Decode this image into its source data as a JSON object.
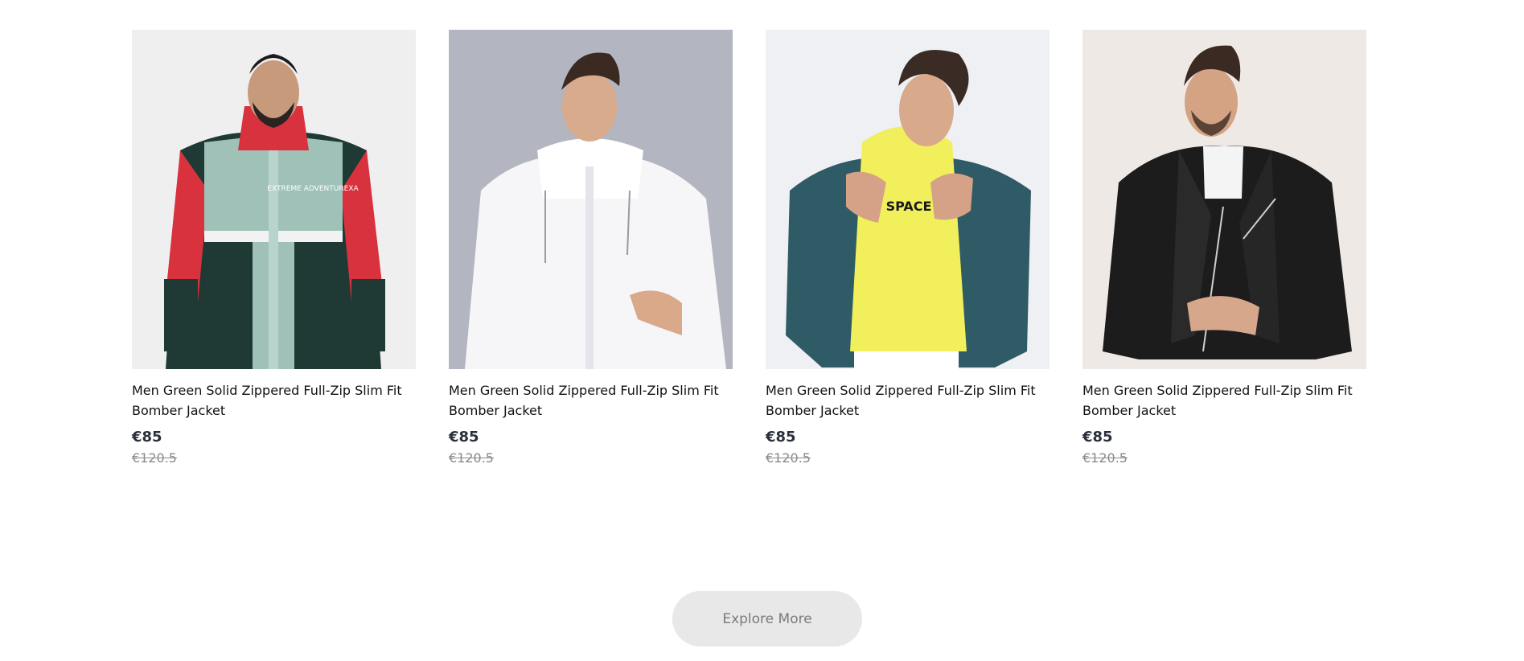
{
  "products": [
    {
      "name": "Men Green Solid Zippered Full-Zip Slim Fit Bomber Jacket",
      "price": "€85",
      "original_price": "€120.5",
      "image_label": "EXTREME ADVENTUREXA",
      "bg": "#efefef"
    },
    {
      "name": "Men Green Solid Zippered Full-Zip Slim Fit Bomber Jacket",
      "price": "€85",
      "original_price": "€120.5",
      "bg": "#b3b5c0"
    },
    {
      "name": "Men Green Solid Zippered Full-Zip Slim Fit Bomber Jacket",
      "price": "€85",
      "original_price": "€120.5",
      "image_label": "SPACE",
      "bg": "#eef0f4"
    },
    {
      "name": "Men Green Solid Zippered Full-Zip Slim Fit Bomber Jacket",
      "price": "€85",
      "original_price": "€120.5",
      "bg": "#efe9e6"
    }
  ],
  "explore_button": {
    "label": "Explore More"
  }
}
